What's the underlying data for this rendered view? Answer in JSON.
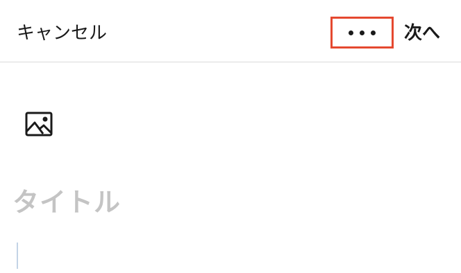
{
  "header": {
    "cancel_label": "キャンセル",
    "more_icon": "more-horizontal-icon",
    "next_label": "次へ",
    "highlight_color": "#e5482f"
  },
  "editor": {
    "image_icon": "image-icon",
    "title_placeholder": "タイトル",
    "placeholder_color": "#c4c4c4"
  }
}
